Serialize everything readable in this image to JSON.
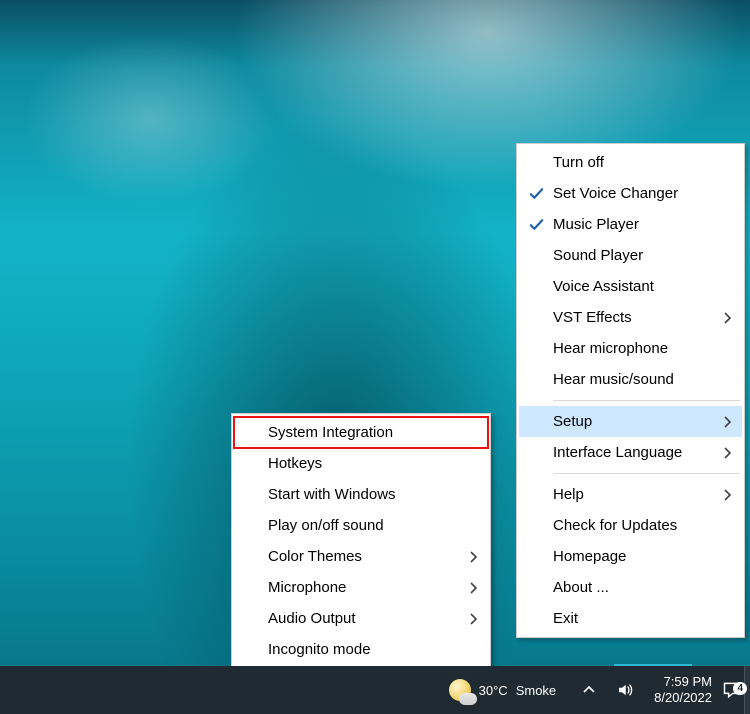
{
  "main_menu": {
    "items": [
      {
        "label": "Turn off",
        "checked": false,
        "submenu": false
      },
      {
        "label": "Set Voice Changer",
        "checked": true,
        "submenu": false
      },
      {
        "label": "Music Player",
        "checked": true,
        "submenu": false
      },
      {
        "label": "Sound Player",
        "checked": false,
        "submenu": false
      },
      {
        "label": "Voice Assistant",
        "checked": false,
        "submenu": false
      },
      {
        "label": "VST Effects",
        "checked": false,
        "submenu": true
      },
      {
        "label": "Hear microphone",
        "checked": false,
        "submenu": false
      },
      {
        "label": "Hear music/sound",
        "checked": false,
        "submenu": false
      }
    ],
    "items2": [
      {
        "label": "Setup",
        "submenu": true,
        "highlight": true
      },
      {
        "label": "Interface Language",
        "submenu": true
      }
    ],
    "items3": [
      {
        "label": "Help",
        "submenu": true
      },
      {
        "label": "Check for Updates"
      },
      {
        "label": "Homepage"
      },
      {
        "label": "About ..."
      },
      {
        "label": "Exit"
      }
    ]
  },
  "setup_submenu": {
    "items": [
      {
        "label": "System Integration",
        "highlight_box": true
      },
      {
        "label": "Hotkeys"
      },
      {
        "label": "Start with Windows"
      },
      {
        "label": "Play on/off sound"
      },
      {
        "label": "Color Themes",
        "submenu": true
      },
      {
        "label": "Microphone",
        "submenu": true
      },
      {
        "label": "Audio Output",
        "submenu": true
      },
      {
        "label": "Incognito mode"
      }
    ]
  },
  "taskbar": {
    "weather_temp": "30°C",
    "weather_cond": "Smoke",
    "time": "7:59 PM",
    "date": "8/20/2022",
    "notif_count": "4"
  }
}
